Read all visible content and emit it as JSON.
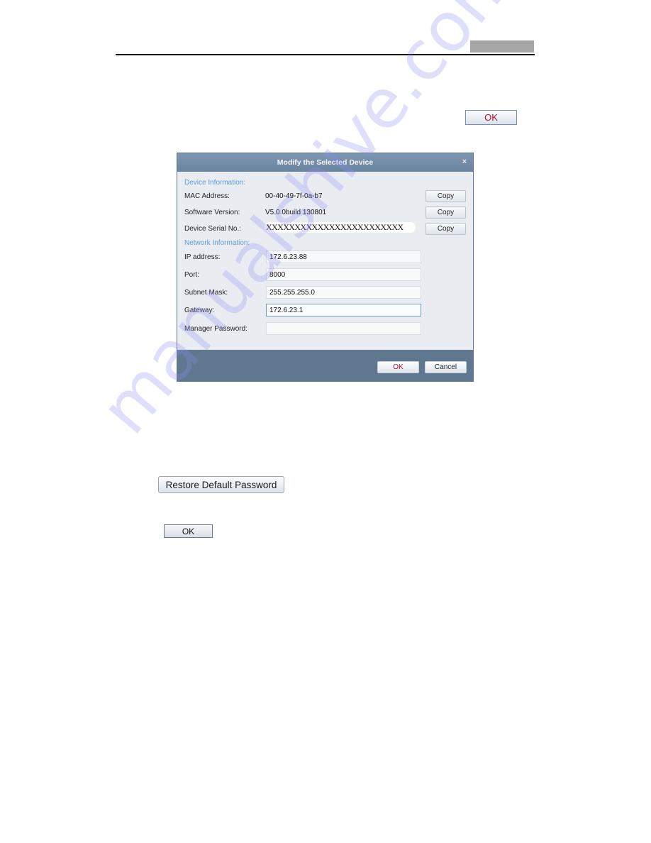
{
  "page": {
    "header_rule": true,
    "top_ok_button": "OK",
    "restore_default_password_button": "Restore Default Password",
    "bottom_ok_button": "OK",
    "watermark": "manualshive.com"
  },
  "dialog": {
    "title": "Modify the Selected Device",
    "close_icon": "×",
    "device_information": {
      "section_label": "Device Information:",
      "rows": [
        {
          "label": "MAC Address:",
          "value": "00-40-49-7f-0a-b7",
          "copy_label": "Copy"
        },
        {
          "label": "Software Version:",
          "value": "V5.0.0build 130801",
          "copy_label": "Copy"
        },
        {
          "label": "Device Serial No.:",
          "value": "XXXXXXXXXXXXXXXXXXXXXXXX",
          "copy_label": "Copy"
        }
      ]
    },
    "network_information": {
      "section_label": "Network Information:",
      "fields": [
        {
          "label": "IP address:",
          "value": "172.6.23.88"
        },
        {
          "label": "Port:",
          "value": "8000"
        },
        {
          "label": "Subnet Mask:",
          "value": "255.255.255.0"
        },
        {
          "label": "Gateway:",
          "value": "172.6.23.1",
          "focused": true
        },
        {
          "label": "Manager Password:",
          "value": ""
        }
      ]
    },
    "buttons": {
      "ok": "OK",
      "cancel": "Cancel"
    }
  }
}
